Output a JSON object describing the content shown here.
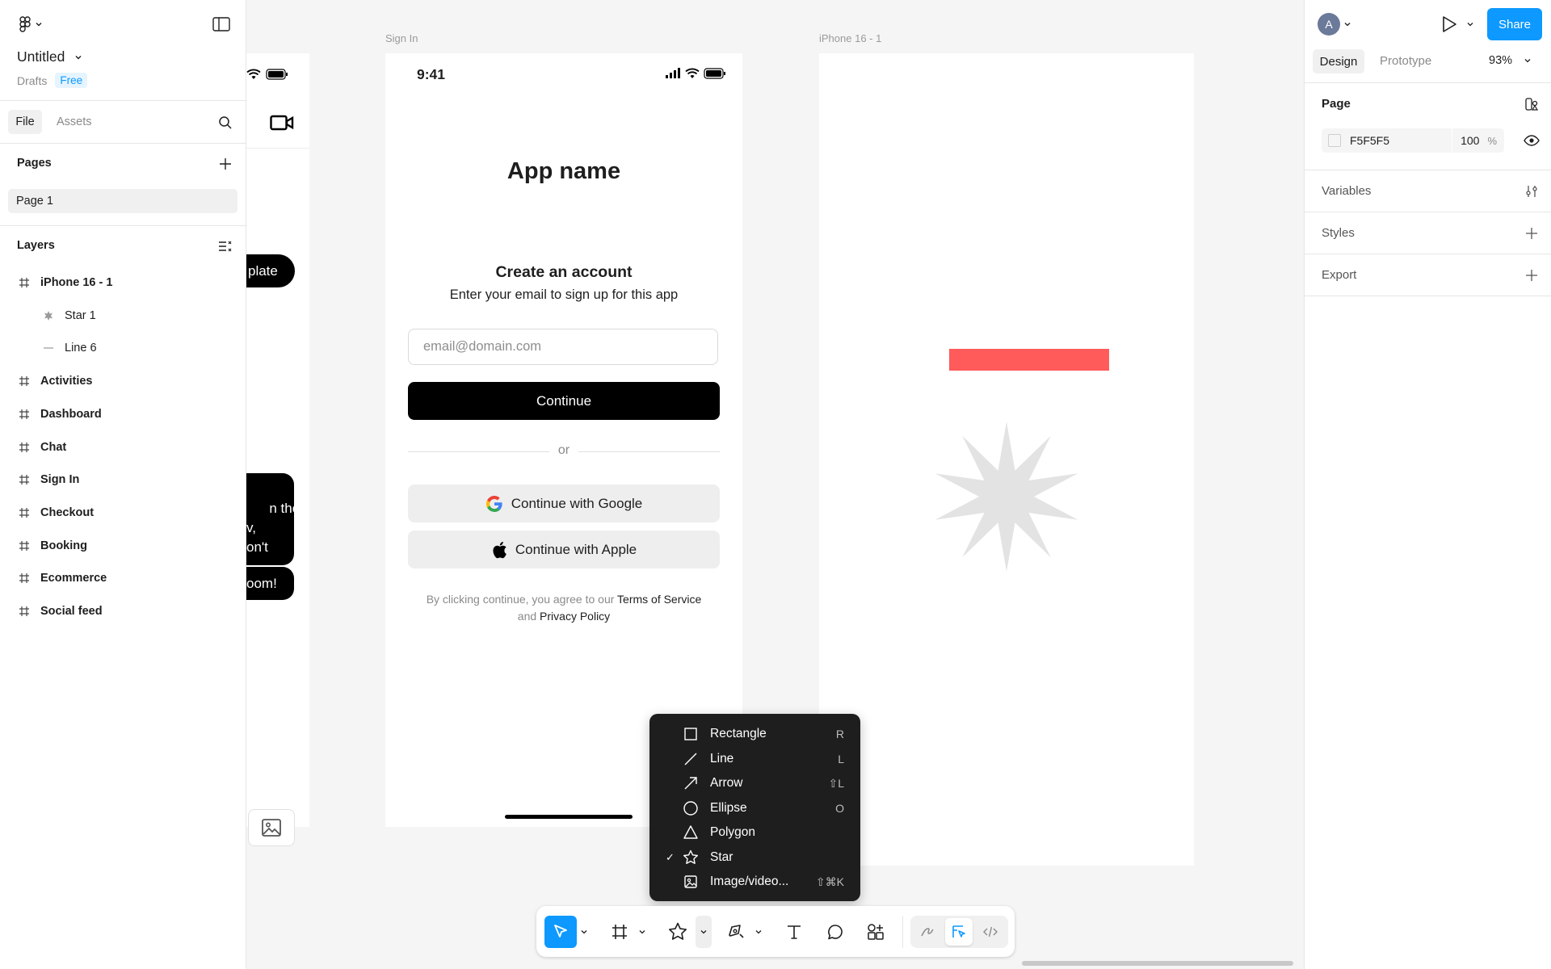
{
  "app": {
    "file_title": "Untitled",
    "location": "Drafts",
    "plan_badge": "Free"
  },
  "left_panel": {
    "tabs": {
      "file": "File",
      "assets": "Assets"
    },
    "pages_label": "Pages",
    "pages": [
      "Page 1"
    ],
    "layers_label": "Layers",
    "layers": [
      {
        "name": "iPhone 16 - 1",
        "type": "frame",
        "indent": 0
      },
      {
        "name": "Star 1",
        "type": "star",
        "indent": 1
      },
      {
        "name": "Line 6",
        "type": "line",
        "indent": 1
      },
      {
        "name": "Activities",
        "type": "frame",
        "indent": 0
      },
      {
        "name": "Dashboard",
        "type": "frame",
        "indent": 0
      },
      {
        "name": "Chat",
        "type": "frame",
        "indent": 0
      },
      {
        "name": "Sign In",
        "type": "frame",
        "indent": 0
      },
      {
        "name": "Checkout",
        "type": "frame",
        "indent": 0
      },
      {
        "name": "Booking",
        "type": "frame",
        "indent": 0
      },
      {
        "name": "Ecommerce",
        "type": "frame",
        "indent": 0
      },
      {
        "name": "Social feed",
        "type": "frame",
        "indent": 0
      }
    ]
  },
  "canvas": {
    "partial_frame": {
      "pill_text": "plate",
      "bubble_text": "n the\nv,\non't",
      "bubble2_text": "oom!"
    },
    "signin_frame": {
      "title": "Sign In",
      "status_time": "9:41",
      "app_name": "App name",
      "heading": "Create an account",
      "subheading": "Enter your email to sign up for this app",
      "email_placeholder": "email@domain.com",
      "continue_label": "Continue",
      "divider_text": "or",
      "google_label": "Continue with Google",
      "apple_label": "Continue with Apple",
      "legal_prefix": "By clicking continue, you agree to our ",
      "legal_terms": "Terms of Service",
      "legal_and": "and ",
      "legal_privacy": "Privacy Policy"
    },
    "iphone_frame": {
      "title": "iPhone 16 - 1",
      "rect_color": "#ff5b5b",
      "star_color": "#e3e3e3"
    }
  },
  "shape_menu": {
    "items": [
      {
        "label": "Rectangle",
        "shortcut": "R",
        "icon": "rectangle-icon",
        "checked": false
      },
      {
        "label": "Line",
        "shortcut": "L",
        "icon": "line-icon",
        "checked": false
      },
      {
        "label": "Arrow",
        "shortcut": "⇧L",
        "icon": "arrow-icon",
        "checked": false
      },
      {
        "label": "Ellipse",
        "shortcut": "O",
        "icon": "ellipse-icon",
        "checked": false
      },
      {
        "label": "Polygon",
        "shortcut": "",
        "icon": "polygon-icon",
        "checked": false
      },
      {
        "label": "Star",
        "shortcut": "",
        "icon": "star-icon",
        "checked": true
      },
      {
        "label": "Image/video...",
        "shortcut": "⇧⌘K",
        "icon": "image-icon",
        "checked": false
      }
    ]
  },
  "right_panel": {
    "avatar_letter": "A",
    "share_label": "Share",
    "tabs": {
      "design": "Design",
      "prototype": "Prototype"
    },
    "zoom": "93%",
    "page_label": "Page",
    "page_color": "F5F5F5",
    "page_opacity": "100",
    "opacity_unit": "%",
    "variables_label": "Variables",
    "styles_label": "Styles",
    "export_label": "Export"
  },
  "help": {
    "label": "?"
  },
  "colors": {
    "accent": "#0d99ff",
    "menu_bg": "#1e1e1e",
    "canvas_bg": "#f5f5f5"
  }
}
